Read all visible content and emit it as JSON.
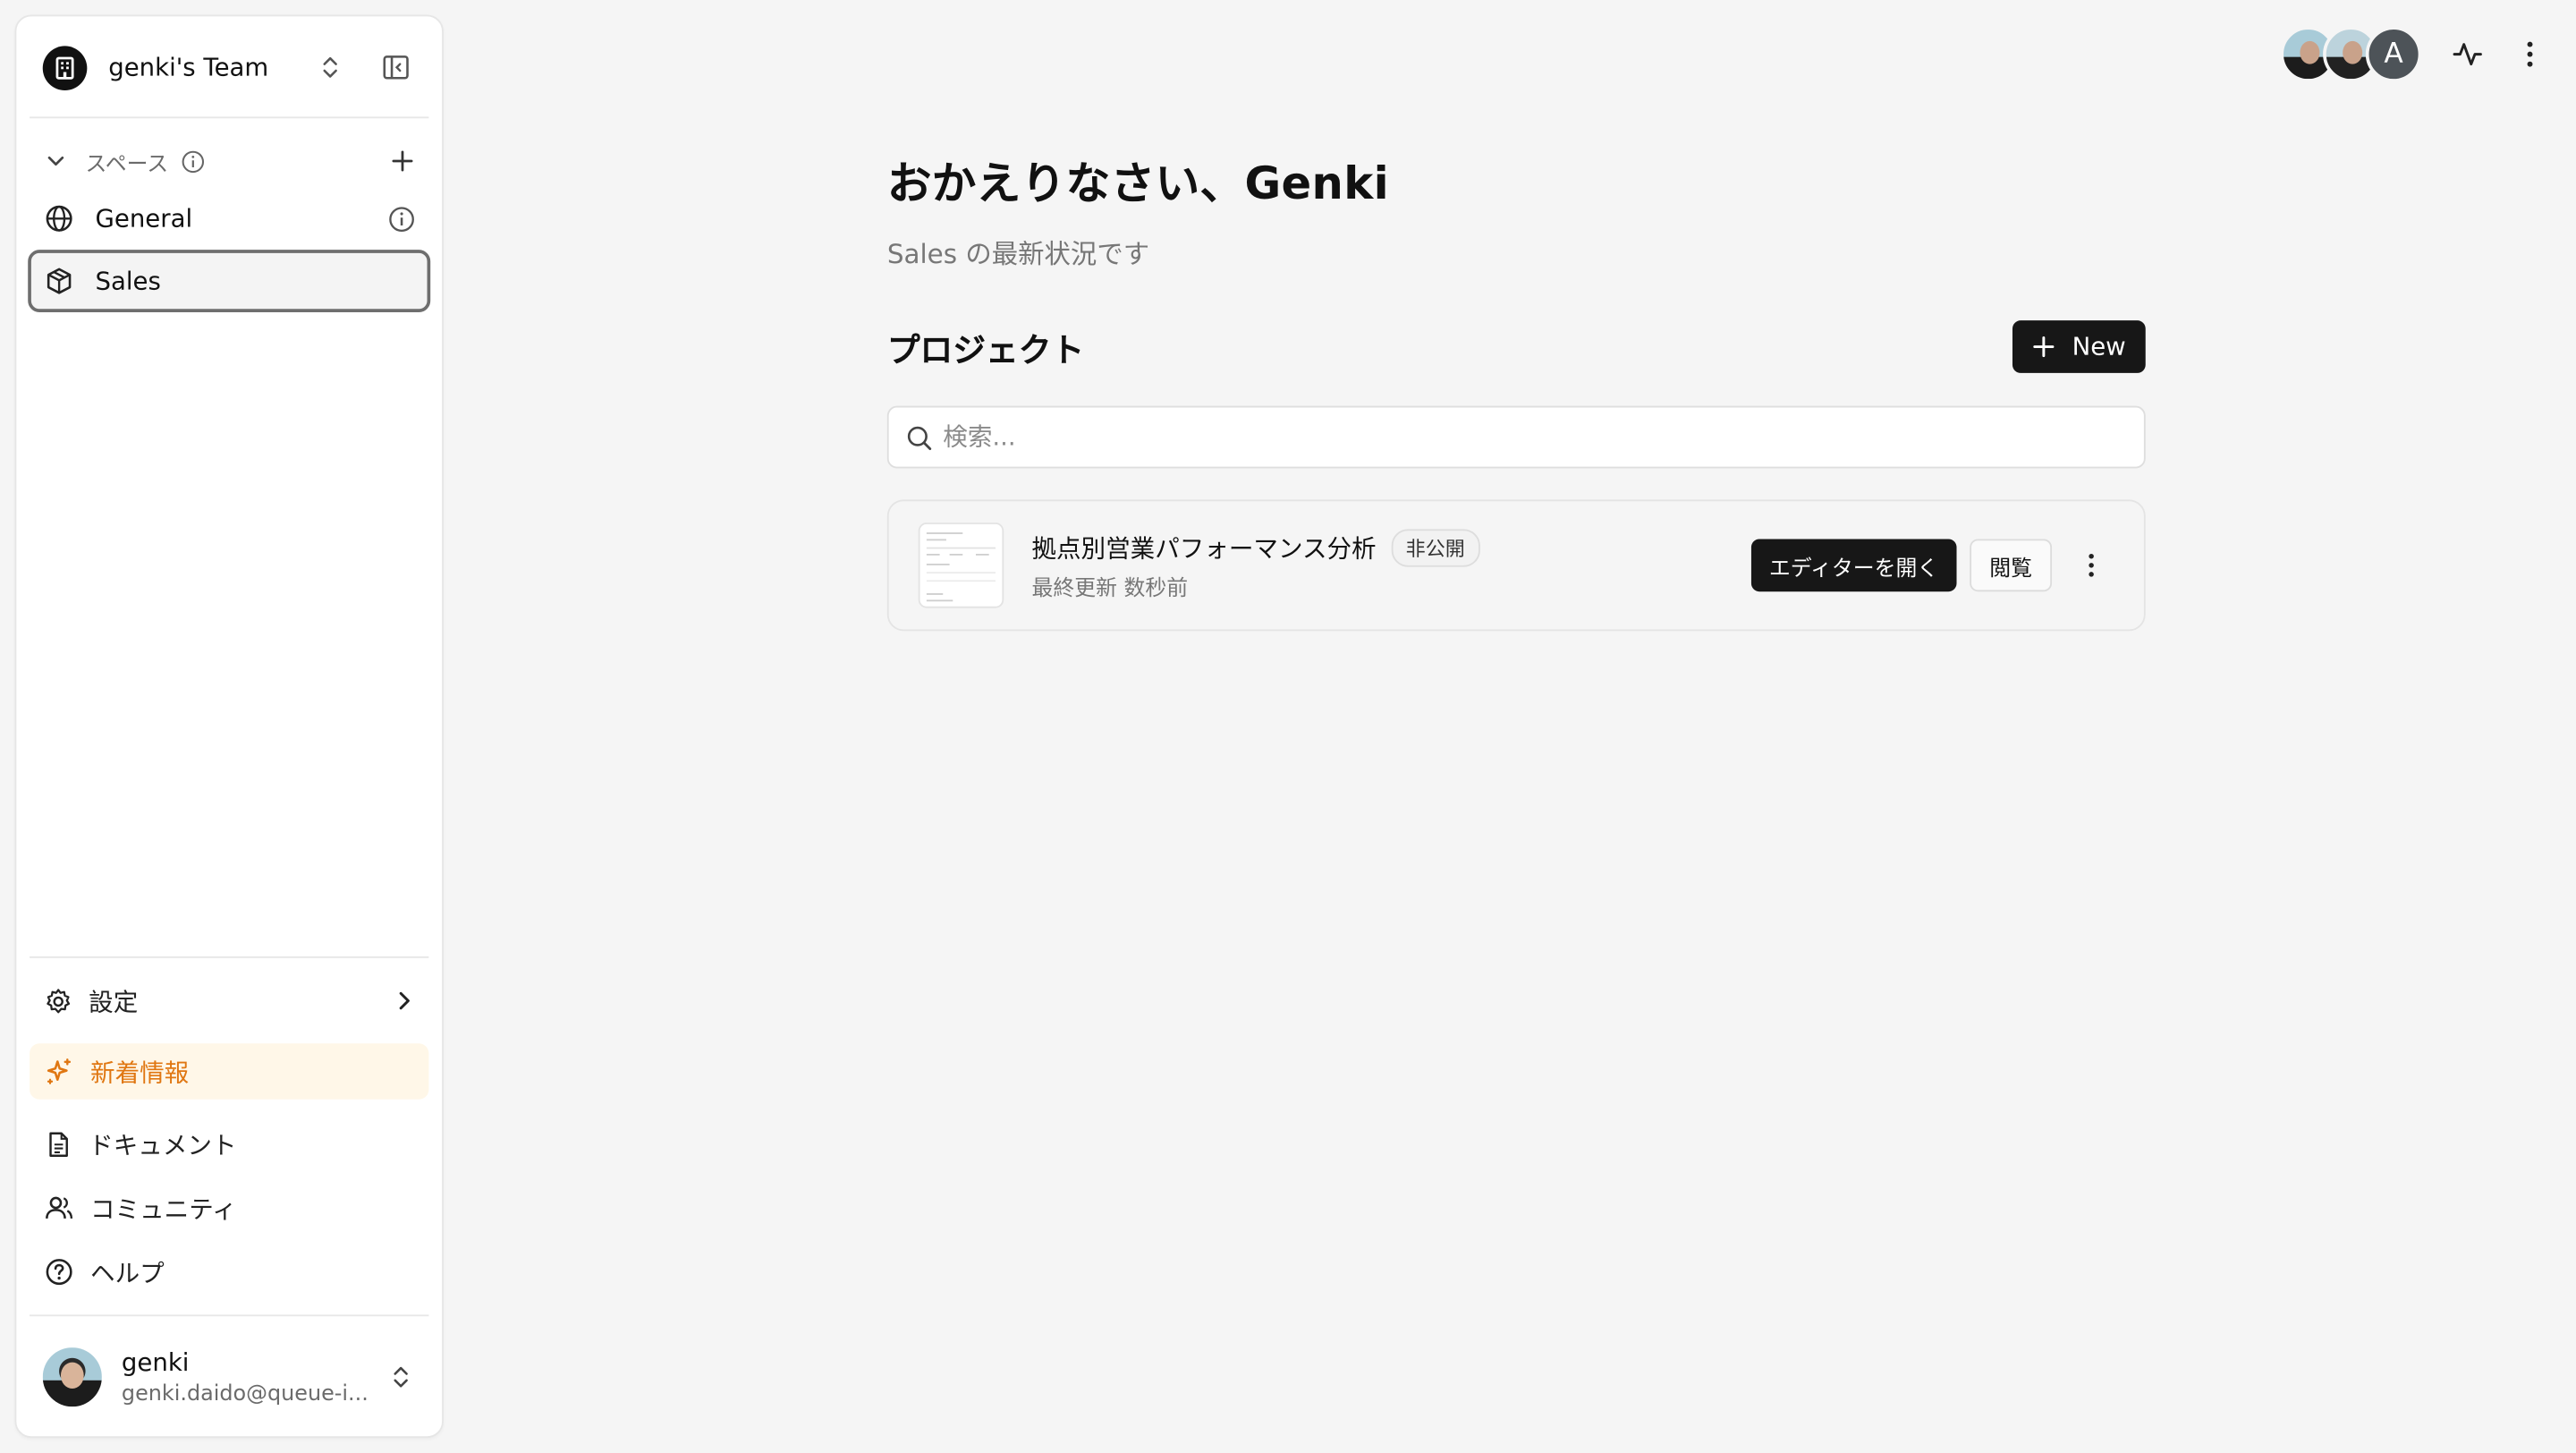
{
  "sidebar": {
    "team_name": "genki's Team",
    "spaces_label": "スペース",
    "spaces": [
      {
        "label": "General",
        "icon": "globe-icon"
      },
      {
        "label": "Sales",
        "icon": "box-icon",
        "active": true
      }
    ],
    "bottom_items": [
      {
        "label": "設定",
        "icon": "gear-icon"
      },
      {
        "label": "新着情報",
        "icon": "sparkle-icon"
      },
      {
        "label": "ドキュメント",
        "icon": "document-icon"
      },
      {
        "label": "コミュニティ",
        "icon": "users-icon"
      },
      {
        "label": "ヘルプ",
        "icon": "help-icon"
      }
    ],
    "user": {
      "name": "genki",
      "email": "genki.daido@queue-i..."
    }
  },
  "topbar": {
    "avatar_letter": "A"
  },
  "main": {
    "greeting": "おかえりなさい、Genki",
    "subtitle": "Sales の最新状況です",
    "section_title": "プロジェクト",
    "new_button": "New",
    "search_placeholder": "検索...",
    "projects": [
      {
        "title": "拠点別営業パフォーマンス分析",
        "badge": "非公開",
        "meta": "最終更新 数秒前",
        "open_label": "エディターを開く",
        "view_label": "閲覧"
      }
    ]
  },
  "colors": {
    "accent_orange": "#e07712",
    "primary_dark": "#171717",
    "background": "#f5f5f5"
  }
}
